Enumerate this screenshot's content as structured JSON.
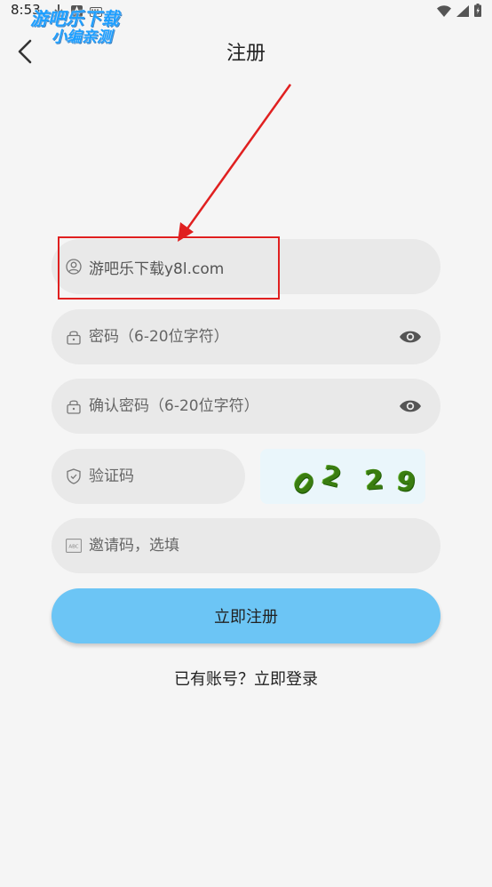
{
  "status_bar": {
    "time": "8:53"
  },
  "watermark": {
    "line1": "游吧乐下载",
    "line2": "小编亲测"
  },
  "header": {
    "title": "注册"
  },
  "form": {
    "username": {
      "value": "游吧乐下载y8l.com",
      "placeholder": ""
    },
    "password": {
      "placeholder": "密码（6-20位字符）"
    },
    "confirm_password": {
      "placeholder": "确认密码（6-20位字符）"
    },
    "captcha": {
      "placeholder": "验证码",
      "image_text": [
        "0",
        "2",
        "2",
        "9"
      ]
    },
    "invite_code": {
      "placeholder": "邀请码，选填"
    }
  },
  "actions": {
    "register_label": "立即注册",
    "login_prompt": "已有账号？立即登录"
  },
  "colors": {
    "accent": "#6cc5f5",
    "field_bg": "#e9e9e9",
    "annotation": "#e02020",
    "captcha_digits": "#3a7d10"
  }
}
